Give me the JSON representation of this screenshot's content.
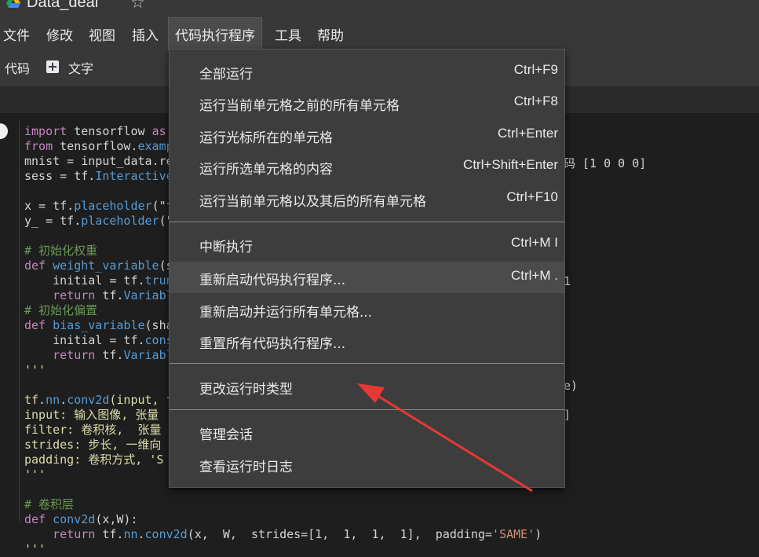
{
  "app": {
    "title": "Data_deal"
  },
  "menubar": {
    "items": [
      "文件",
      "修改",
      "视图",
      "插入",
      "代码执行程序",
      "工具",
      "帮助"
    ],
    "active": "代码执行程序"
  },
  "toolbar": {
    "code_label": "代码",
    "text_label": "文字"
  },
  "dropdown": {
    "groups": [
      [
        {
          "label": "全部运行",
          "shortcut": "Ctrl+F9"
        },
        {
          "label": "运行当前单元格之前的所有单元格",
          "shortcut": "Ctrl+F8"
        },
        {
          "label": "运行光标所在的单元格",
          "shortcut": "Ctrl+Enter"
        },
        {
          "label": "运行所选单元格的内容",
          "shortcut": "Ctrl+Shift+Enter"
        },
        {
          "label": "运行当前单元格以及其后的所有单元格",
          "shortcut": "Ctrl+F10"
        }
      ],
      [
        {
          "label": "中断执行",
          "shortcut": "Ctrl+M I"
        },
        {
          "label": "重新启动代码执行程序...",
          "shortcut": "Ctrl+M ."
        },
        {
          "label": "重新启动并运行所有单元格...",
          "shortcut": ""
        },
        {
          "label": "重置所有代码执行程序...",
          "shortcut": ""
        }
      ],
      [
        {
          "label": "更改运行时类型",
          "shortcut": ""
        }
      ],
      [
        {
          "label": "管理会话",
          "shortcut": ""
        },
        {
          "label": "查看运行时日志",
          "shortcut": ""
        }
      ]
    ]
  },
  "code": {
    "lines": [
      "import tensorflow as",
      "from tensorflow.examp",
      "mnist = input_data.re",
      "sess = tf.Interactive",
      "",
      "x = tf.placeholder(\"f",
      "y_ = tf.placeholder(\"",
      "",
      "# 初始化权重",
      "def weight_variable(s",
      "    initial = tf.trun",
      "    return tf.Variabl",
      "# 初始化偏置",
      "def bias_variable(sha",
      "    initial = tf.cons",
      "    return tf.Variabl",
      "'''",
      "",
      "tf.nn.conv2d(input, f",
      "input: 输入图像, 张量",
      "filter: 卷积核,  张量",
      "strides: 步长, 一维向",
      "padding: 卷积方式, 'S",
      "'''",
      "",
      "# 卷积层",
      "def conv2d(x,W):",
      "    return tf.nn.conv2d(x,  W,  strides=[1,  1,  1,  1],  padding='SAME')",
      "'''"
    ],
    "right_fragments": [
      "码 [1 0 0 0]",
      "1",
      "e)",
      "]"
    ]
  },
  "colors": {
    "menu_bg": "#3d3d3d",
    "hover_bg": "#4b4b4b",
    "arrow": "#e53935"
  }
}
